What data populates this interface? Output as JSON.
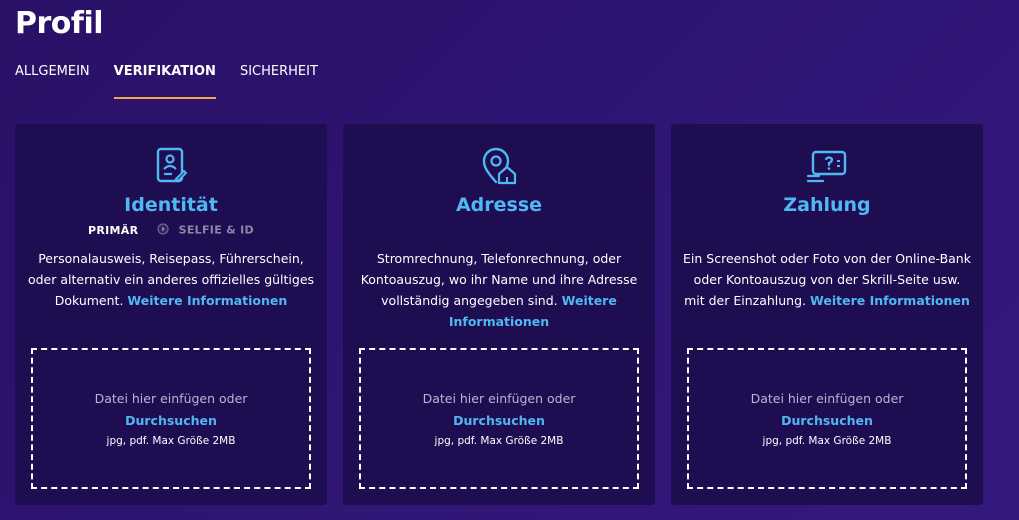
{
  "page": {
    "title": "Profil"
  },
  "tabs": [
    {
      "label": "ALLGEMEIN"
    },
    {
      "label": "VERIFIKATION"
    },
    {
      "label": "SICHERHEIT"
    }
  ],
  "accent_color": "#4fb8f2",
  "tab_underline_color": "#f0a64c",
  "cards": [
    {
      "icon": "id-card-icon",
      "title": "Identität",
      "primary_label": "PRIMÄR",
      "secondary_label": "SELFIE & ID",
      "description": "Personalausweis, Reisepass, Führerschein, oder alternativ ein anderes offizielles gültiges Dokument.",
      "link": "Weitere Informationen",
      "drop_text": "Datei hier einfügen oder",
      "browse": "Durchsuchen",
      "hint": "jpg, pdf. Max Größe 2MB"
    },
    {
      "icon": "location-home-icon",
      "title": "Adresse",
      "description": "Stromrechnung, Telefonrechnung, oder Kontoauszug, wo ihr Name und ihre Adresse vollständig angegeben sind.",
      "link": "Weitere Informationen",
      "drop_text": "Datei hier einfügen oder",
      "browse": "Durchsuchen",
      "hint": "jpg, pdf. Max Größe 2MB"
    },
    {
      "icon": "payment-card-icon",
      "title": "Zahlung",
      "description": "Ein Screenshot oder Foto von der Online-Bank oder Kontoauszug von der Skrill-Seite usw. mit der Einzahlung.",
      "link": "Weitere Informationen",
      "drop_text": "Datei hier einfügen oder",
      "browse": "Durchsuchen",
      "hint": "jpg, pdf. Max Größe 2MB"
    }
  ]
}
